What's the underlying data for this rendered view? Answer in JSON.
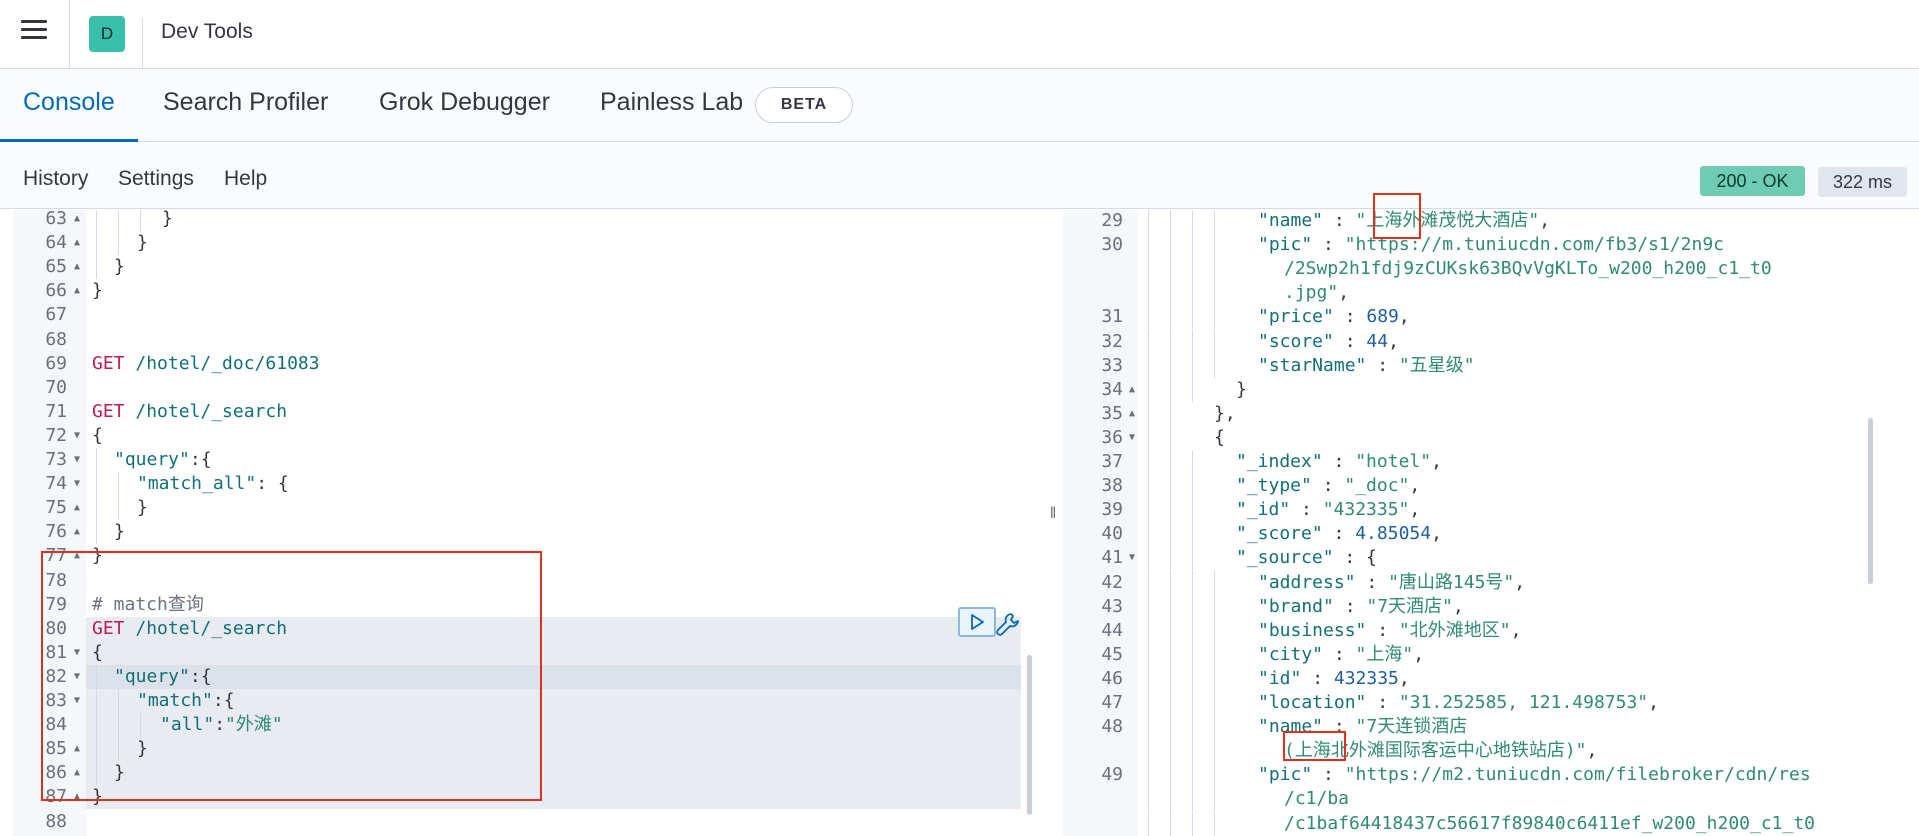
{
  "header": {
    "app_initial": "D",
    "title": "Dev Tools"
  },
  "tabs": [
    {
      "label": "Console"
    },
    {
      "label": "Search Profiler"
    },
    {
      "label": "Grok Debugger"
    },
    {
      "label": "Painless Lab"
    }
  ],
  "beta_badge": "BETA",
  "subnav": {
    "history": "History",
    "settings": "Settings",
    "help": "Help",
    "status": "200 - OK",
    "time": "322 ms"
  },
  "resize_handle": "‖",
  "editor_lines": [
    {
      "n": "63",
      "f": "▲",
      "parts": [
        [
          "o",
          "}"
        ]
      ]
    },
    {
      "n": "64",
      "f": "▲",
      "parts": [
        [
          "o",
          "}"
        ]
      ]
    },
    {
      "n": "65",
      "f": "▲",
      "parts": [
        [
          "o",
          "}"
        ]
      ]
    },
    {
      "n": "66",
      "f": "▲",
      "parts": [
        [
          "o",
          "}"
        ]
      ]
    },
    {
      "n": "67",
      "f": "",
      "parts": []
    },
    {
      "n": "68",
      "f": "",
      "parts": []
    },
    {
      "n": "69",
      "f": "",
      "parts": [
        [
          "k",
          "GET"
        ],
        [
          "p",
          " /hotel/_doc/61083"
        ]
      ]
    },
    {
      "n": "70",
      "f": "",
      "parts": []
    },
    {
      "n": "71",
      "f": "",
      "parts": [
        [
          "k",
          "GET"
        ],
        [
          "p",
          " /hotel/_search"
        ]
      ]
    },
    {
      "n": "72",
      "f": "▼",
      "parts": [
        [
          "o",
          "{"
        ]
      ]
    },
    {
      "n": "73",
      "f": "▼",
      "parts": [
        [
          "p",
          "\"query\""
        ],
        [
          "o",
          ":{"
        ]
      ]
    },
    {
      "n": "74",
      "f": "▼",
      "parts": [
        [
          "p",
          "\"match_all\""
        ],
        [
          "o",
          ": {"
        ]
      ]
    },
    {
      "n": "75",
      "f": "▲",
      "parts": [
        [
          "o",
          "}"
        ]
      ]
    },
    {
      "n": "76",
      "f": "▲",
      "parts": [
        [
          "o",
          "}"
        ]
      ]
    },
    {
      "n": "77",
      "f": "▲",
      "parts": [
        [
          "o",
          "}"
        ]
      ]
    },
    {
      "n": "78",
      "f": "",
      "parts": []
    },
    {
      "n": "79",
      "f": "",
      "parts": [
        [
          "c",
          "# match查询"
        ]
      ]
    },
    {
      "n": "80",
      "f": "",
      "parts": [
        [
          "k",
          "GET"
        ],
        [
          "p",
          " /hotel/_search"
        ]
      ]
    },
    {
      "n": "81",
      "f": "▼",
      "parts": [
        [
          "o",
          "{"
        ]
      ]
    },
    {
      "n": "82",
      "f": "▼",
      "parts": [
        [
          "p",
          "\"query\""
        ],
        [
          "o",
          ":{"
        ]
      ]
    },
    {
      "n": "83",
      "f": "▼",
      "parts": [
        [
          "p",
          "\"match\""
        ],
        [
          "o",
          ":{"
        ]
      ]
    },
    {
      "n": "84",
      "f": "",
      "parts": [
        [
          "p",
          "\"all\""
        ],
        [
          "o",
          ":"
        ],
        [
          "s",
          "\"外滩\""
        ]
      ]
    },
    {
      "n": "85",
      "f": "▲",
      "parts": [
        [
          "o",
          "}"
        ]
      ]
    },
    {
      "n": "86",
      "f": "▲",
      "parts": [
        [
          "o",
          "}"
        ]
      ]
    },
    {
      "n": "87",
      "f": "▲",
      "parts": [
        [
          "o",
          "}"
        ]
      ]
    },
    {
      "n": "88",
      "f": "",
      "parts": []
    }
  ],
  "output_lines": [
    {
      "n": "29",
      "f": "",
      "parts": [
        [
          "p",
          "\"name\""
        ],
        [
          "o",
          " : "
        ],
        [
          "s",
          "\"上海外滩茂悦大酒店\""
        ],
        [
          "o",
          ","
        ]
      ]
    },
    {
      "n": "30",
      "f": "",
      "parts": [
        [
          "p",
          "\"pic\""
        ],
        [
          "o",
          " : "
        ],
        [
          "s",
          "\"https://m.tuniucdn.com/fb3/s1/2n9c"
        ]
      ]
    },
    {
      "n": "",
      "f": "",
      "parts": [
        [
          "s",
          "/2Swp2h1fdj9zCUKsk63BQvVgKLTo_w200_h200_c1_t0"
        ]
      ]
    },
    {
      "n": "",
      "f": "",
      "parts": [
        [
          "s",
          ".jpg\""
        ],
        [
          "o",
          ","
        ]
      ]
    },
    {
      "n": "31",
      "f": "",
      "parts": [
        [
          "p",
          "\"price\""
        ],
        [
          "o",
          " : "
        ],
        [
          "n",
          "689"
        ],
        [
          "o",
          ","
        ]
      ]
    },
    {
      "n": "32",
      "f": "",
      "parts": [
        [
          "p",
          "\"score\""
        ],
        [
          "o",
          " : "
        ],
        [
          "n",
          "44"
        ],
        [
          "o",
          ","
        ]
      ]
    },
    {
      "n": "33",
      "f": "",
      "parts": [
        [
          "p",
          "\"starName\""
        ],
        [
          "o",
          " : "
        ],
        [
          "s",
          "\"五星级\""
        ]
      ]
    },
    {
      "n": "34",
      "f": "▲",
      "parts": [
        [
          "o",
          "}"
        ]
      ]
    },
    {
      "n": "35",
      "f": "▲",
      "parts": [
        [
          "o",
          "},"
        ]
      ]
    },
    {
      "n": "36",
      "f": "▼",
      "parts": [
        [
          "o",
          "{"
        ]
      ]
    },
    {
      "n": "37",
      "f": "",
      "parts": [
        [
          "p",
          "\"_index\""
        ],
        [
          "o",
          " : "
        ],
        [
          "s",
          "\"hotel\""
        ],
        [
          "o",
          ","
        ]
      ]
    },
    {
      "n": "38",
      "f": "",
      "parts": [
        [
          "p",
          "\"_type\""
        ],
        [
          "o",
          " : "
        ],
        [
          "s",
          "\"_doc\""
        ],
        [
          "o",
          ","
        ]
      ]
    },
    {
      "n": "39",
      "f": "",
      "parts": [
        [
          "p",
          "\"_id\""
        ],
        [
          "o",
          " : "
        ],
        [
          "s",
          "\"432335\""
        ],
        [
          "o",
          ","
        ]
      ]
    },
    {
      "n": "40",
      "f": "",
      "parts": [
        [
          "p",
          "\"_score\""
        ],
        [
          "o",
          " : "
        ],
        [
          "n",
          "4.85054"
        ],
        [
          "o",
          ","
        ]
      ]
    },
    {
      "n": "41",
      "f": "▼",
      "parts": [
        [
          "p",
          "\"_source\""
        ],
        [
          "o",
          " : {"
        ]
      ]
    },
    {
      "n": "42",
      "f": "",
      "parts": [
        [
          "p",
          "\"address\""
        ],
        [
          "o",
          " : "
        ],
        [
          "s",
          "\"唐山路145号\""
        ],
        [
          "o",
          ","
        ]
      ]
    },
    {
      "n": "43",
      "f": "",
      "parts": [
        [
          "p",
          "\"brand\""
        ],
        [
          "o",
          " : "
        ],
        [
          "s",
          "\"7天酒店\""
        ],
        [
          "o",
          ","
        ]
      ]
    },
    {
      "n": "44",
      "f": "",
      "parts": [
        [
          "p",
          "\"business\""
        ],
        [
          "o",
          " : "
        ],
        [
          "s",
          "\"北外滩地区\""
        ],
        [
          "o",
          ","
        ]
      ]
    },
    {
      "n": "45",
      "f": "",
      "parts": [
        [
          "p",
          "\"city\""
        ],
        [
          "o",
          " : "
        ],
        [
          "s",
          "\"上海\""
        ],
        [
          "o",
          ","
        ]
      ]
    },
    {
      "n": "46",
      "f": "",
      "parts": [
        [
          "p",
          "\"id\""
        ],
        [
          "o",
          " : "
        ],
        [
          "n",
          "432335"
        ],
        [
          "o",
          ","
        ]
      ]
    },
    {
      "n": "47",
      "f": "",
      "parts": [
        [
          "p",
          "\"location\""
        ],
        [
          "o",
          " : "
        ],
        [
          "s",
          "\"31.252585, 121.498753\""
        ],
        [
          "o",
          ","
        ]
      ]
    },
    {
      "n": "48",
      "f": "",
      "parts": [
        [
          "p",
          "\"name\""
        ],
        [
          "o",
          " : "
        ],
        [
          "s",
          "\"7天连锁酒店"
        ]
      ]
    },
    {
      "n": "",
      "f": "",
      "parts": [
        [
          "s",
          "(上海北外滩国际客运中心地铁站店)\""
        ],
        [
          "o",
          ","
        ]
      ]
    },
    {
      "n": "49",
      "f": "",
      "parts": [
        [
          "p",
          "\"pic\""
        ],
        [
          "o",
          " : "
        ],
        [
          "s",
          "\"https://m2.tuniucdn.com/filebroker/cdn/res"
        ]
      ]
    },
    {
      "n": "",
      "f": "",
      "parts": [
        [
          "s",
          "/c1/ba"
        ]
      ]
    },
    {
      "n": "",
      "f": "",
      "parts": [
        [
          "s",
          "/c1baf64418437c56617f89840c6411ef_w200_h200_c1_t0"
        ]
      ]
    }
  ]
}
